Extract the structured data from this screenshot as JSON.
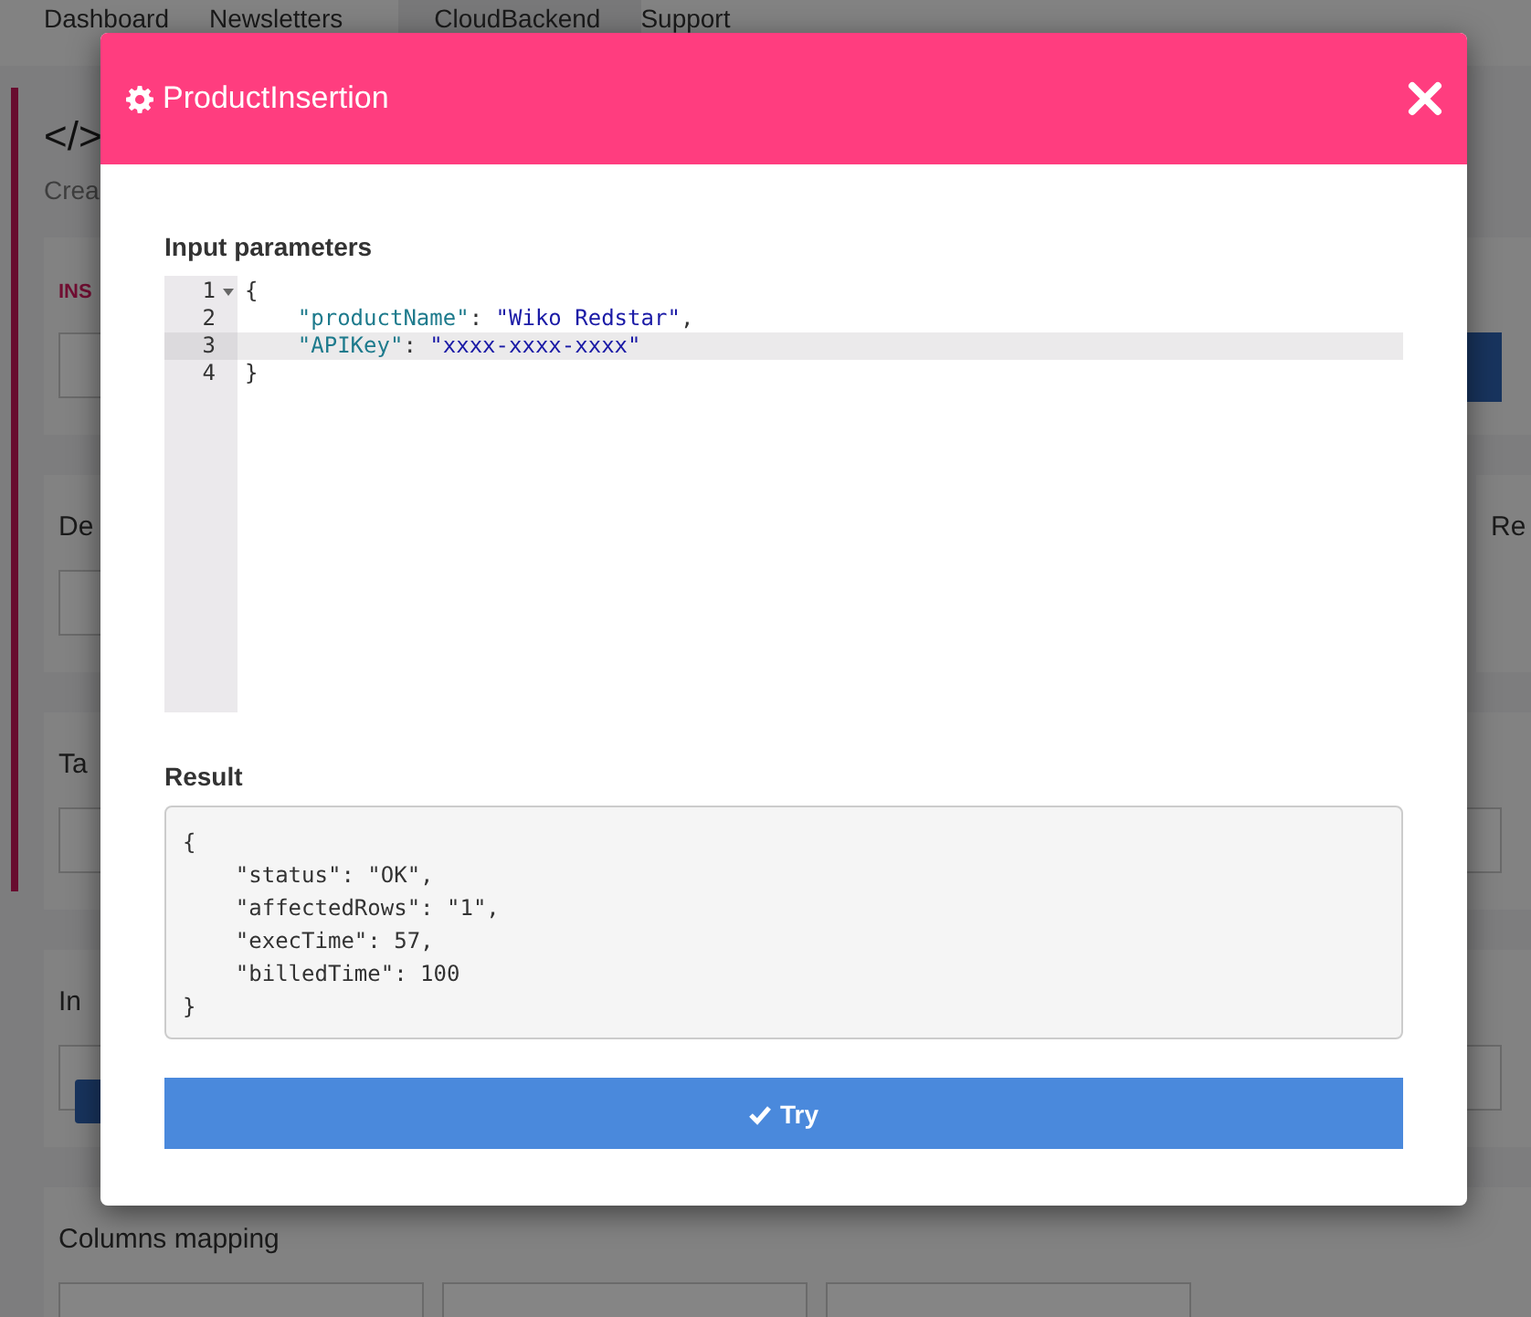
{
  "nav": {
    "tabs": [
      {
        "label": "Dashboard",
        "selected": false
      },
      {
        "label": "Newsletters",
        "selected": false
      },
      {
        "label": "CloudBackend",
        "selected": true
      },
      {
        "label": "Support",
        "selected": false
      }
    ]
  },
  "page": {
    "icon_text": "</>",
    "subtitle": "Crea",
    "cards": [
      {
        "kind": "select",
        "title": "INS"
      },
      {
        "kind": "split",
        "title": "De",
        "side_title": "Re"
      },
      {
        "kind": "field",
        "title": "Ta"
      },
      {
        "kind": "tags",
        "title": "In"
      },
      {
        "kind": "mapping",
        "title": "Columns mapping"
      }
    ]
  },
  "modal": {
    "title": "ProductInsertion",
    "input_label": "Input parameters",
    "code_lines": [
      {
        "number": "1",
        "foldable": true,
        "highlighted": false,
        "parts": [
          {
            "kind": "punct",
            "text": "{"
          }
        ]
      },
      {
        "number": "2",
        "foldable": false,
        "highlighted": false,
        "parts": [
          {
            "kind": "key",
            "text": "\"productName\""
          },
          {
            "kind": "punct",
            "text": ": "
          },
          {
            "kind": "string",
            "text": "\"Wiko Redstar\""
          },
          {
            "kind": "punct",
            "text": ","
          }
        ]
      },
      {
        "number": "3",
        "foldable": false,
        "highlighted": true,
        "parts": [
          {
            "kind": "key",
            "text": "\"APIKey\""
          },
          {
            "kind": "punct",
            "text": ": "
          },
          {
            "kind": "string",
            "text": "\"xxxx-xxxx-xxxx\""
          }
        ]
      },
      {
        "number": "4",
        "foldable": false,
        "highlighted": false,
        "parts": [
          {
            "kind": "punct",
            "text": "}"
          }
        ]
      }
    ],
    "result_label": "Result",
    "result": "{\n    \"status\": \"OK\",\n    \"affectedRows\": \"1\",\n    \"execTime\": 57,\n    \"billedTime\": 100\n}",
    "button": "Try"
  }
}
